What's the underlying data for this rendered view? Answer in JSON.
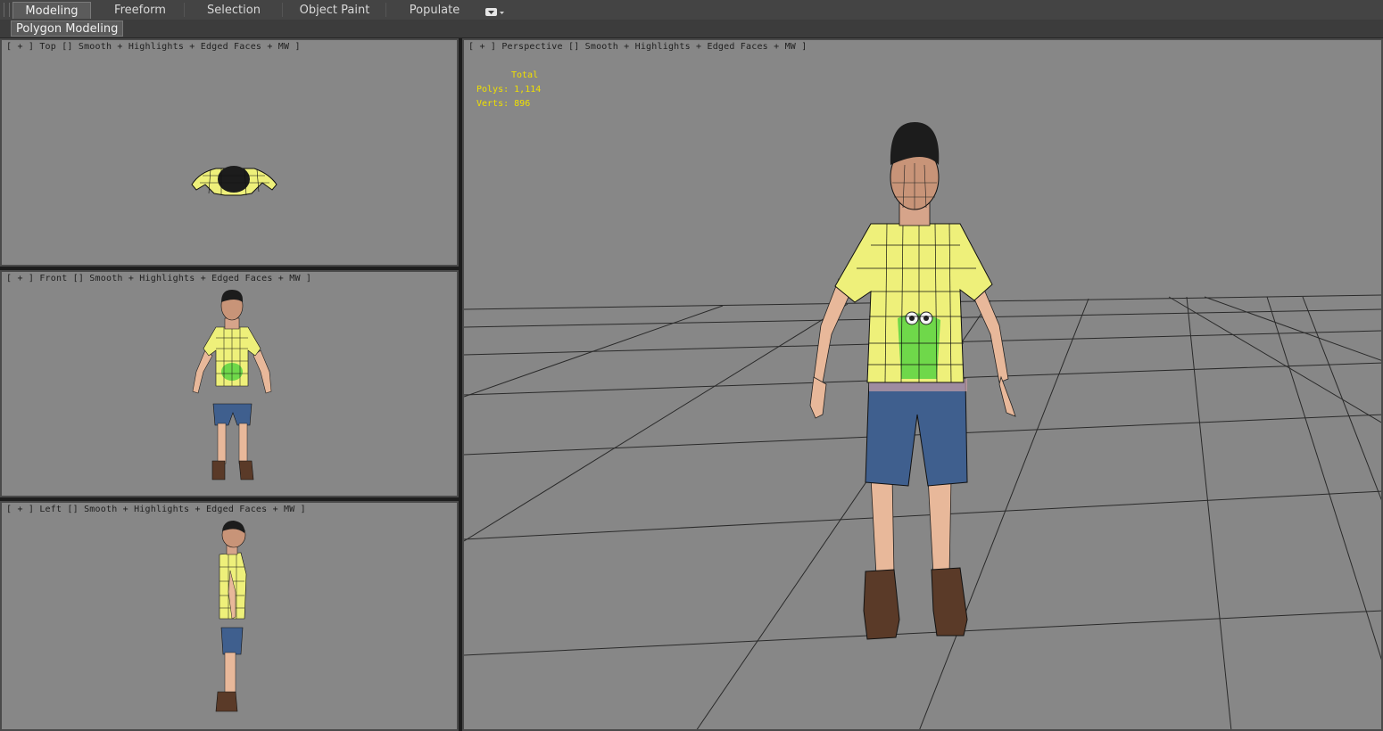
{
  "ribbon": {
    "tabs": [
      {
        "label": "Modeling",
        "active": true
      },
      {
        "label": "Freeform",
        "active": false
      },
      {
        "label": "Selection",
        "active": false
      },
      {
        "label": "Object Paint",
        "active": false
      },
      {
        "label": "Populate",
        "active": false
      }
    ],
    "sub_tab": "Polygon Modeling",
    "dropdown_icon": "dropdown-menu-icon"
  },
  "viewports": {
    "top": {
      "label": "[ + ] Top [] Smooth + Highlights + Edged Faces + MW ]"
    },
    "front": {
      "label": "[ + ] Front [] Smooth + Highlights + Edged Faces + MW ]"
    },
    "left": {
      "label": "[ + ] Left [] Smooth + Highlights + Edged Faces + MW ]"
    },
    "perspective": {
      "label": "[ + ] Perspective [] Smooth + Highlights + Edged Faces + MW ]",
      "stats": {
        "header": "Total",
        "polys_label": "Polys:",
        "polys_value": "1,114",
        "verts_label": "Verts:",
        "verts_value": "896"
      }
    }
  },
  "colors": {
    "viewport_bg": "#878787",
    "stats_text": "#f0e000",
    "shirt": "#eef07a",
    "shorts": "#3f5f8e",
    "skin": "#e8b89a",
    "boots": "#5a3a28",
    "hair": "#1c1c1c",
    "frog": "#6fd84a"
  }
}
